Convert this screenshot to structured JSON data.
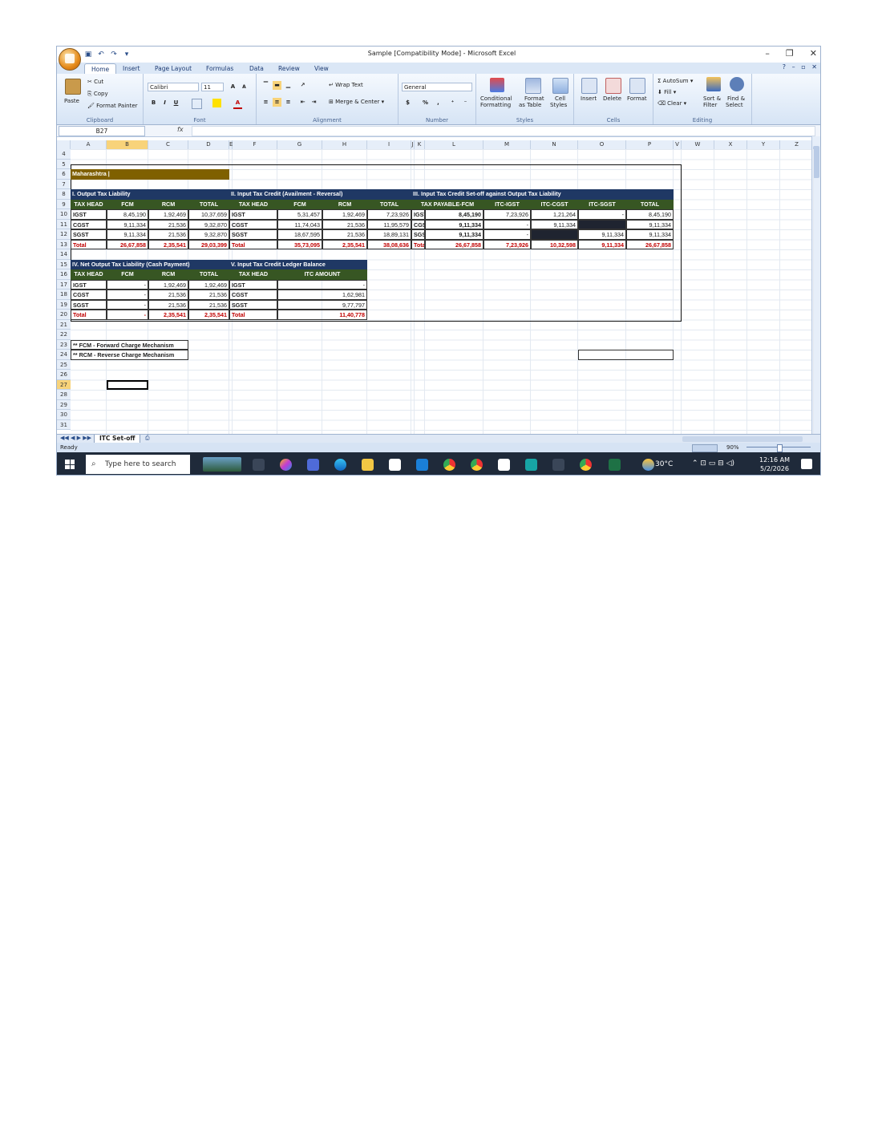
{
  "window": {
    "title": "Sample  [Compatibility Mode] - Microsoft Excel"
  },
  "ribbon": {
    "tabs": [
      "Home",
      "Insert",
      "Page Layout",
      "Formulas",
      "Data",
      "Review",
      "View"
    ],
    "clipboard": {
      "paste": "Paste",
      "cut": "Cut",
      "copy": "Copy",
      "format_painter": "Format Painter",
      "label": "Clipboard"
    },
    "font": {
      "name": "Calibri",
      "size": "11",
      "bold": "B",
      "italic": "I",
      "underline": "U",
      "label": "Font"
    },
    "alignment": {
      "wrap": "Wrap Text",
      "merge": "Merge & Center",
      "label": "Alignment"
    },
    "number": {
      "format": "General",
      "currency": "$",
      "percent": "%",
      "comma": ",",
      "label": "Number"
    },
    "styles": {
      "conditional": "Conditional",
      "conditional2": "Formatting",
      "format_table": "Format",
      "format_table2": "as Table",
      "cell_styles": "Cell",
      "cell_styles2": "Styles",
      "label": "Styles"
    },
    "cells": {
      "insert": "Insert",
      "delete": "Delete",
      "format": "Format",
      "label": "Cells"
    },
    "editing": {
      "autosum": "AutoSum",
      "fill": "Fill",
      "clear": "Clear",
      "sort": "Sort &",
      "sort2": "Filter",
      "find": "Find &",
      "find2": "Select",
      "label": "Editing"
    }
  },
  "formula_bar": {
    "name_box": "B27",
    "fx": "fx",
    "value": ""
  },
  "columns": [
    "A",
    "B",
    "C",
    "D",
    "E",
    "F",
    "G",
    "H",
    "I",
    "J",
    "K",
    "L",
    "M",
    "N",
    "O",
    "P",
    "V",
    "W",
    "X",
    "Y",
    "Z"
  ],
  "rows": [
    "4",
    "5",
    "6",
    "7",
    "8",
    "9",
    "10",
    "11",
    "12",
    "13",
    "14",
    "15",
    "16",
    "17",
    "18",
    "19",
    "20",
    "21",
    "22",
    "23",
    "24",
    "25",
    "26",
    "27",
    "28",
    "29",
    "30",
    "31"
  ],
  "sheet": {
    "state_label": "Maharashtra |",
    "t1": {
      "title": "I. Output Tax Liability",
      "headers": [
        "TAX HEAD",
        "FCM",
        "RCM",
        "TOTAL"
      ],
      "rows": [
        [
          "IGST",
          "8,45,190",
          "1,92,469",
          "10,37,659"
        ],
        [
          "CGST",
          "9,11,334",
          "21,536",
          "9,32,870"
        ],
        [
          "SGST",
          "9,11,334",
          "21,536",
          "9,32,870"
        ],
        [
          "Total",
          "26,67,858",
          "2,35,541",
          "29,03,399"
        ]
      ]
    },
    "t2": {
      "title": "II. Input Tax Credit (Availment - Reversal)",
      "headers": [
        "TAX HEAD",
        "FCM",
        "RCM",
        "TOTAL"
      ],
      "rows": [
        [
          "IGST",
          "5,31,457",
          "1,92,469",
          "7,23,926"
        ],
        [
          "CGST",
          "11,74,043",
          "21,536",
          "11,95,579"
        ],
        [
          "SGST",
          "18,67,595",
          "21,536",
          "18,89,131"
        ],
        [
          "Total",
          "35,73,095",
          "2,35,541",
          "38,08,636"
        ]
      ]
    },
    "t3": {
      "title": "III. Input Tax Credit Set-off against Output Tax Liability",
      "headers": [
        "TAX PAYABLE-FCM",
        "ITC-IGST",
        "ITC-CGST",
        "ITC-SGST",
        "TOTAL"
      ],
      "rows": [
        [
          "IGST",
          "8,45,190",
          "7,23,926",
          "1,21,264",
          "-",
          "8,45,190"
        ],
        [
          "CGST",
          "9,11,334",
          "-",
          "9,11,334",
          "",
          "9,11,334"
        ],
        [
          "SGST",
          "9,11,334",
          "-",
          "",
          "9,11,334",
          "9,11,334"
        ],
        [
          "Total",
          "26,67,858",
          "7,23,926",
          "10,32,598",
          "9,11,334",
          "26,67,858"
        ]
      ]
    },
    "t4": {
      "title": "IV. Net Output Tax Liability (Cash Payment)",
      "headers": [
        "TAX HEAD",
        "FCM",
        "RCM",
        "TOTAL"
      ],
      "rows": [
        [
          "IGST",
          "-",
          "1,92,469",
          "1,92,469"
        ],
        [
          "CGST",
          "-",
          "21,536",
          "21,536"
        ],
        [
          "SGST",
          "-",
          "21,536",
          "21,536"
        ],
        [
          "Total",
          "-",
          "2,35,541",
          "2,35,541"
        ]
      ]
    },
    "t5": {
      "title": "V. Input Tax Credit Ledger Balance",
      "headers": [
        "TAX HEAD",
        "ITC AMOUNT"
      ],
      "rows": [
        [
          "IGST",
          "-"
        ],
        [
          "CGST",
          "1,62,981"
        ],
        [
          "SGST",
          "9,77,797"
        ],
        [
          "Total",
          "11,40,778"
        ]
      ]
    },
    "notes": [
      "** FCM - Forward Charge Mechanism",
      "** RCM - Reverse Charge Mechanism"
    ],
    "tab_name": "ITC Set-off"
  },
  "status": {
    "ready": "Ready",
    "zoom": "90%"
  },
  "taskbar": {
    "search_placeholder": "Type here to search",
    "temperature": "30°C",
    "time": "12:16 AM",
    "date": "5/2/2026"
  }
}
